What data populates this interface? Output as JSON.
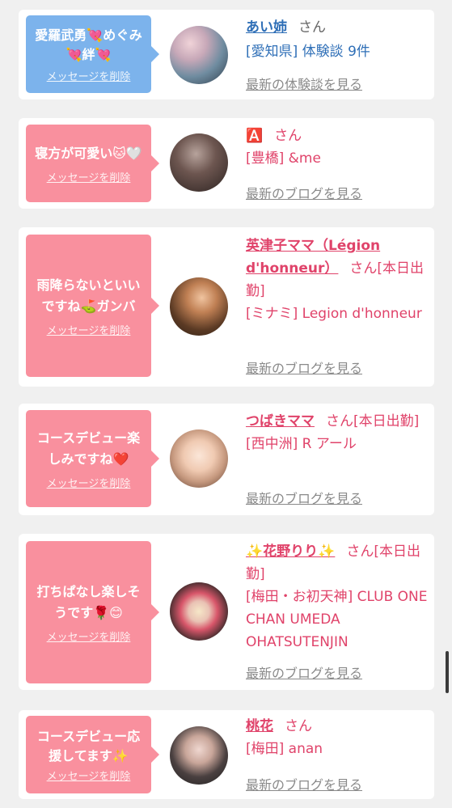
{
  "cards": [
    {
      "message": "愛羅武勇💘めぐみ💘絆💘",
      "delete_label": "メッセージを削除",
      "name": "あい姉",
      "honorific": "さん",
      "location": "[愛知県] 体験談 9件",
      "link": "最新の体験談を見る",
      "theme": "blue"
    },
    {
      "message": "寝方が可愛い🐱🤍",
      "delete_label": "メッセージを削除",
      "name": "🅰️",
      "honorific": "さん",
      "location": "[豊橋] &me",
      "link": "最新のブログを見る",
      "theme": "pink"
    },
    {
      "message": "雨降らないといいですね⛳ガンバ",
      "delete_label": "メッセージを削除",
      "name": "英津子ママ（Légion d'honneur）",
      "honorific": "さん[本日出勤]",
      "location": "[ミナミ] Legion d'honneur",
      "link": "最新のブログを見る",
      "theme": "pink"
    },
    {
      "message": "コースデビュー楽しみですね❤️",
      "delete_label": "メッセージを削除",
      "name": "つばきママ",
      "honorific": "さん[本日出勤]",
      "location": "[西中洲] R アール",
      "link": "最新のブログを見る",
      "theme": "pink"
    },
    {
      "message": "打ちぱなし楽しそうです🌹😊",
      "delete_label": "メッセージを削除",
      "name": "✨花野りり✨",
      "honorific": "さん[本日出勤]",
      "location": "[梅田・お初天神] CLUB ONE CHAN UMEDA OHATSUTENJIN",
      "link": "最新のブログを見る",
      "theme": "pink"
    },
    {
      "message": "コースデビュー応援してます✨",
      "delete_label": "メッセージを削除",
      "name": "桃花",
      "honorific": "さん",
      "location": "[梅田] anan",
      "link": "最新のブログを見る",
      "theme": "pink"
    }
  ],
  "colors": {
    "bubble_blue": "#7cb3ec",
    "bubble_pink": "#f9909e",
    "name_pink": "#e0436a",
    "name_blue": "#2f6fb7",
    "link_gray": "#8a8a8a"
  }
}
